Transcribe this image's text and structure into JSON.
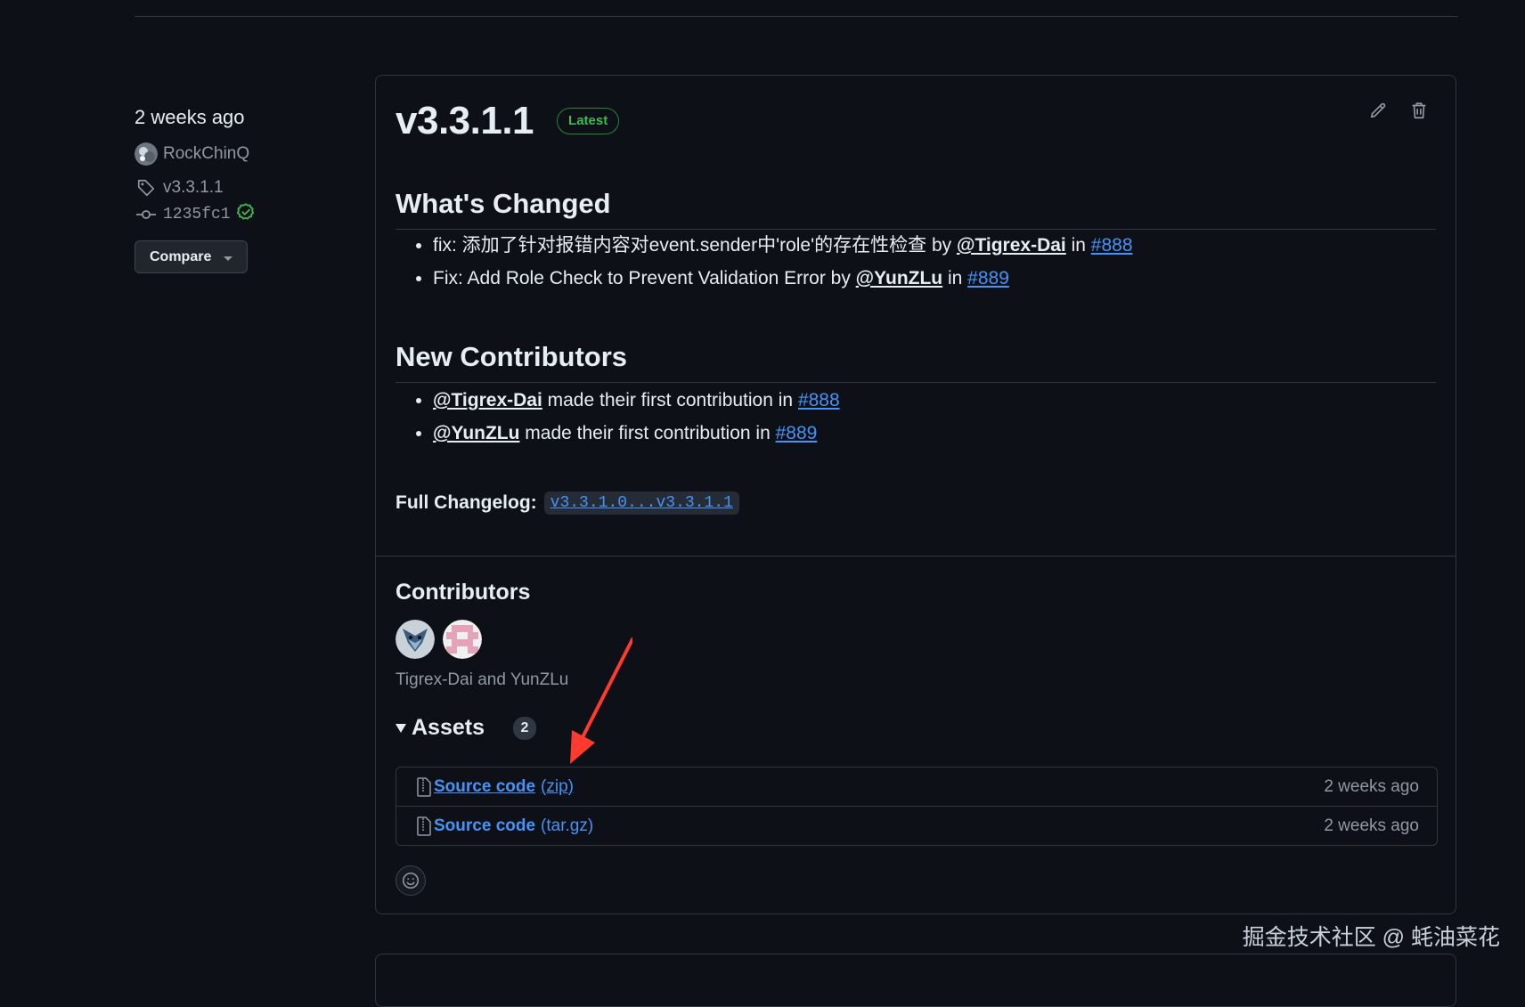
{
  "meta": {
    "date": "2 weeks ago",
    "author": "RockChinQ",
    "tag": "v3.3.1.1",
    "commit": "1235fc1",
    "compare_label": "Compare"
  },
  "release": {
    "title": "v3.3.1.1",
    "badge": "Latest",
    "whats_changed": {
      "heading": "What's Changed",
      "items": [
        {
          "text": "fix: 添加了针对报错内容对event.sender中'role'的存在性检查 by ",
          "mention": "@Tigrex-Dai",
          "mid": " in ",
          "pr": "#888"
        },
        {
          "text": "Fix: Add Role Check to Prevent Validation Error by ",
          "mention": "@YunZLu",
          "mid": " in ",
          "pr": "#889"
        }
      ]
    },
    "new_contributors": {
      "heading": "New Contributors",
      "items": [
        {
          "mention": "@Tigrex-Dai",
          "text": " made their first contribution in ",
          "pr": "#888"
        },
        {
          "mention": "@YunZLu",
          "text": " made their first contribution in ",
          "pr": "#889"
        }
      ]
    },
    "full_changelog": {
      "label": "Full Changelog:",
      "link": "v3.3.1.0...v3.3.1.1"
    },
    "contributors": {
      "heading": "Contributors",
      "names": "Tigrex-Dai and YunZLu"
    },
    "assets": {
      "heading": "Assets",
      "count": "2",
      "items": [
        {
          "name": "Source code",
          "ext": "(zip)",
          "time": "2 weeks ago"
        },
        {
          "name": "Source code",
          "ext": "(tar.gz)",
          "time": "2 weeks ago"
        }
      ]
    }
  },
  "watermark": "掘金技术社区 @ 蚝油菜花",
  "colors": {
    "bg": "#0d1117",
    "link": "#4493f8",
    "border": "#30363d",
    "badge_green": "#3fb950",
    "arrow_red": "#ff3b30"
  },
  "icons": [
    "tag-icon",
    "commit-icon",
    "check-circle-icon",
    "pencil-icon",
    "trash-icon",
    "file-zip-icon",
    "smiley-icon",
    "triangle-down-icon"
  ]
}
